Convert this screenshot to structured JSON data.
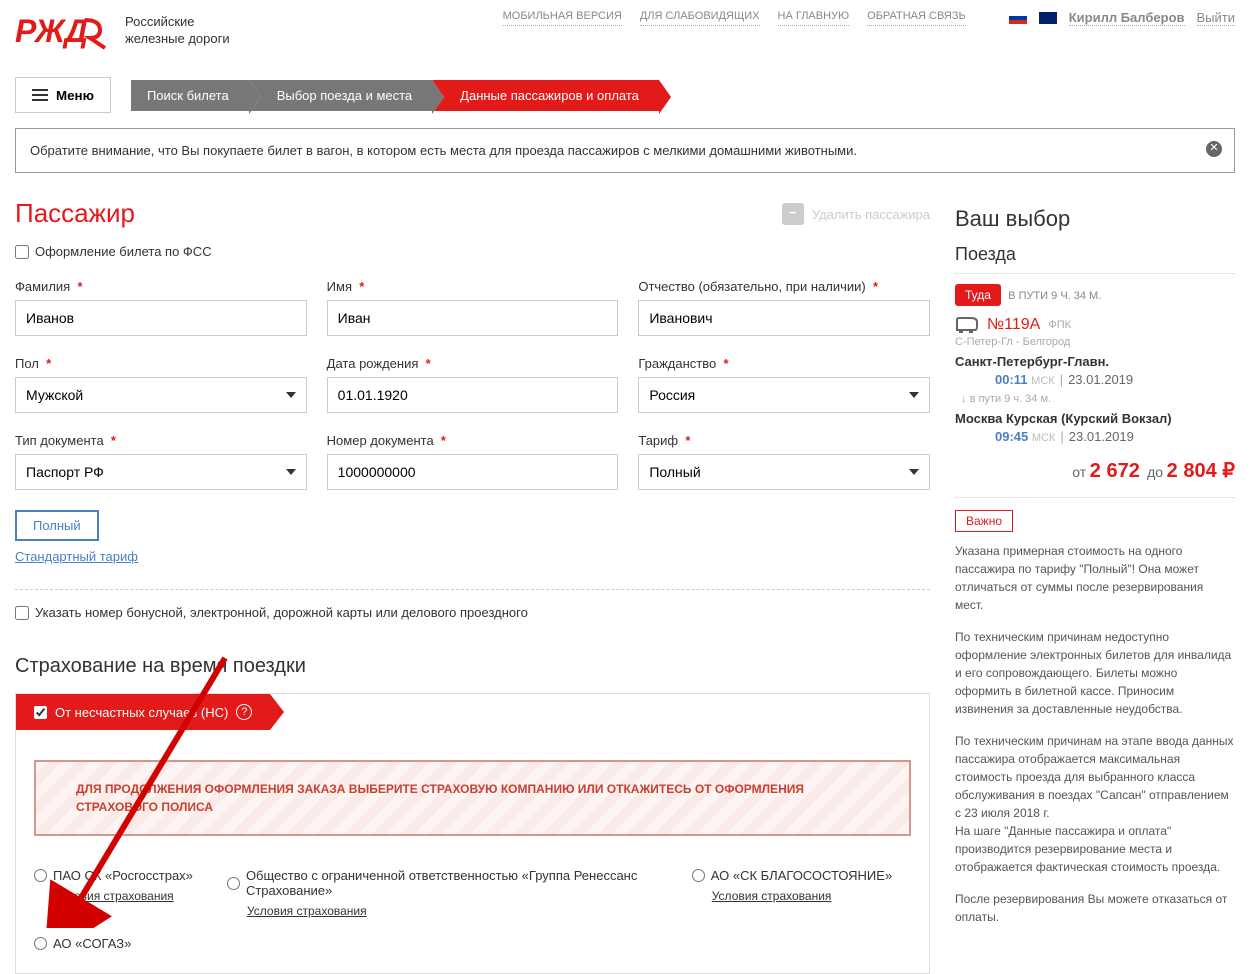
{
  "header": {
    "company_line1": "Российские",
    "company_line2": "железные дороги",
    "nav": {
      "mobile": "МОБИЛЬНАЯ ВЕРСИЯ",
      "accessibility": "ДЛЯ СЛАБОВИДЯЩИХ",
      "home": "НА ГЛАВНУЮ",
      "feedback": "ОБРАТНАЯ СВЯЗЬ"
    },
    "user": "Кирилл Балберов",
    "logout": "Выйти",
    "menu": "Меню"
  },
  "breadcrumb": {
    "step1": "Поиск билета",
    "step2": "Выбор поезда и места",
    "step3": "Данные пассажиров и оплата"
  },
  "notice": "Обратите внимание, что Вы покупаете билет в вагон, в котором есть места для проезда пассажиров с мелкими домашними животными.",
  "passenger": {
    "title": "Пассажир",
    "delete": "Удалить пассажира",
    "fss": "Оформление билета по ФСС",
    "labels": {
      "surname": "Фамилия",
      "name": "Имя",
      "patronymic": "Отчество (обязательно, при наличии)",
      "gender": "Пол",
      "birthdate": "Дата рождения",
      "citizenship": "Гражданство",
      "doctype": "Тип документа",
      "docnumber": "Номер документа",
      "tariff": "Тариф"
    },
    "values": {
      "surname": "Иванов",
      "name": "Иван",
      "patronymic": "Иванович",
      "gender": "Мужской",
      "birthdate": "01.01.1920",
      "citizenship": "Россия",
      "doctype": "Паспорт РФ",
      "docnumber": "1000000000",
      "tariff": "Полный"
    },
    "tariff_full": "Полный",
    "tariff_standard": "Стандартный тариф",
    "bonus_card": "Указать номер бонусной, электронной, дорожной карты или делового проездного"
  },
  "insurance": {
    "title": "Страхование на время поездки",
    "accident": "От несчастных случаев (НС)",
    "warning": "ДЛЯ ПРОДОЛЖЕНИЯ ОФОРМЛЕНИЯ ЗАКАЗА ВЫБЕРИТЕ СТРАХОВУЮ КОМПАНИЮ ИЛИ ОТКАЖИТЕСЬ ОТ ОФОРМЛЕНИЯ СТРАХОВОГО ПОЛИСА",
    "terms": "Условия страхования",
    "options": {
      "rosgosstrah": "ПАО СК «Росгосстрах»",
      "renaissance": "Общество с ограниченной ответственностью «Группа Ренессанс Страхование»",
      "blago": "АО «СК БЛАГОСОСТОЯНИЕ»",
      "sogaz": "АО «СОГАЗ»"
    }
  },
  "sidebar": {
    "title": "Ваш выбор",
    "trains": "Поезда",
    "direction": "Туда",
    "travel_time": "В ПУТИ 9 Ч. 34 М.",
    "train_number": "№119А",
    "train_company": "ФПК",
    "route_short": "С-Петер-Гл - Белгород",
    "station_from": "Санкт-Петербург-Главн.",
    "time_from": "00:11",
    "tz": "МСК",
    "date": "23.01.2019",
    "enroute": "в пути  9 ч. 34 м.",
    "station_to": "Москва Курская (Курский Вокзал)",
    "time_to": "09:45",
    "price_from_label": "от",
    "price_from": "2 672",
    "price_to_label": "до",
    "price_to": "2 804 ₽",
    "important": "Важно",
    "info1": "Указана примерная стоимость на одного пассажира по тарифу \"Полный\"! Она может отличаться от суммы после резервирования мест.",
    "info2": "По техническим причинам недоступно оформление электронных билетов для инвалида и его сопровождающего. Билеты можно оформить в билетной кассе. Приносим извинения за доставленные неудобства.",
    "info3": "По техническим причинам на этапе ввода данных пассажира отображается максимальная стоимость проезда для выбранного класса обслуживания в поездах \"Сапсан\" отправлением с 23 июля 2018 г.",
    "info3b": "На шаге \"Данные пассажира и оплата\" производится резервирование места и отображается фактическая стоимость проезда.",
    "info4": "После резервирования Вы можете отказаться от оплаты."
  }
}
